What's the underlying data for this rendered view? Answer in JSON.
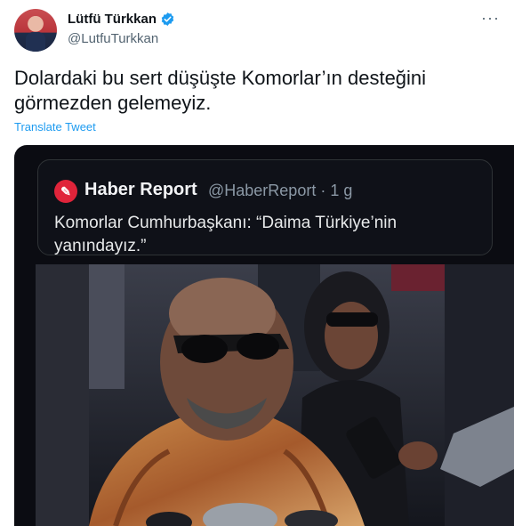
{
  "author": {
    "name": "Lütfü Türkkan",
    "handle": "@LutfuTurkkan",
    "verified": true
  },
  "tweet": {
    "text": "Dolardaki bu sert düşüşte Komorlar’ın desteğini görmezden gelemeyiz.",
    "translate_label": "Translate Tweet"
  },
  "quoted": {
    "name": "Haber Report",
    "handle": "@HaberReport",
    "time": "· 1 g",
    "text": "Komorlar Cumhurbaşkanı: “Daima Türkiye’nin yanındayız.”"
  },
  "icons": {
    "verified": "verified-badge-icon",
    "more": "more-options-icon",
    "logo": "haber-report-logo-icon"
  },
  "colors": {
    "link": "#1d9bf0",
    "verified": "#1d9bf0",
    "logo": "#e0243a"
  }
}
